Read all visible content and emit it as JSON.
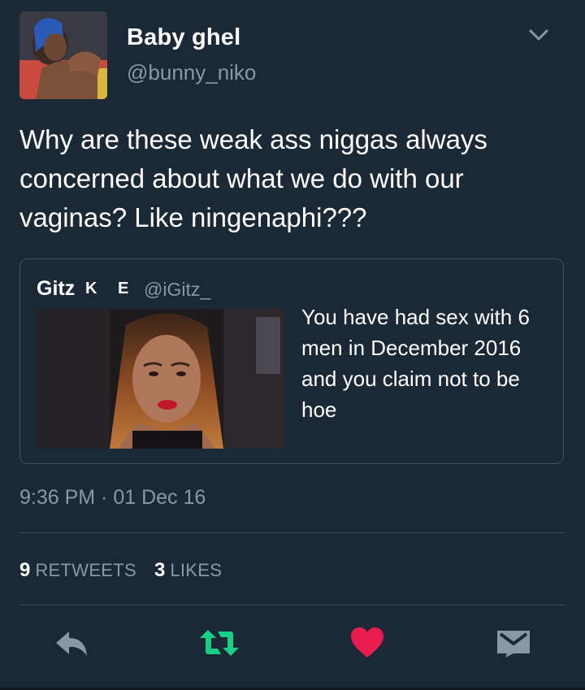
{
  "tweet": {
    "display_name": "Baby ghel",
    "handle": "@bunny_niko",
    "text": "Why are these weak ass niggas always concerned about what we do with our vaginas? Like ningenaphi???",
    "timestamp": "9:36 PM · 01 Dec 16"
  },
  "quote": {
    "name": "Gitz",
    "flags": "K E",
    "handle": "@iGitz_",
    "text": "You have had sex with 6 men in December 2016 and you claim not to be hoe"
  },
  "stats": {
    "retweets_count": "9",
    "retweets_label": "RETWEETS",
    "likes_count": "3",
    "likes_label": "LIKES"
  },
  "actions": [
    {
      "icon": "reply-icon"
    },
    {
      "icon": "retweet-icon"
    },
    {
      "icon": "heart-icon"
    },
    {
      "icon": "message-icon"
    }
  ],
  "colors": {
    "background": "#1b2836",
    "secondary_text": "#8899a6",
    "retweet_active": "#19cf86",
    "like_active": "#e81c4f"
  }
}
